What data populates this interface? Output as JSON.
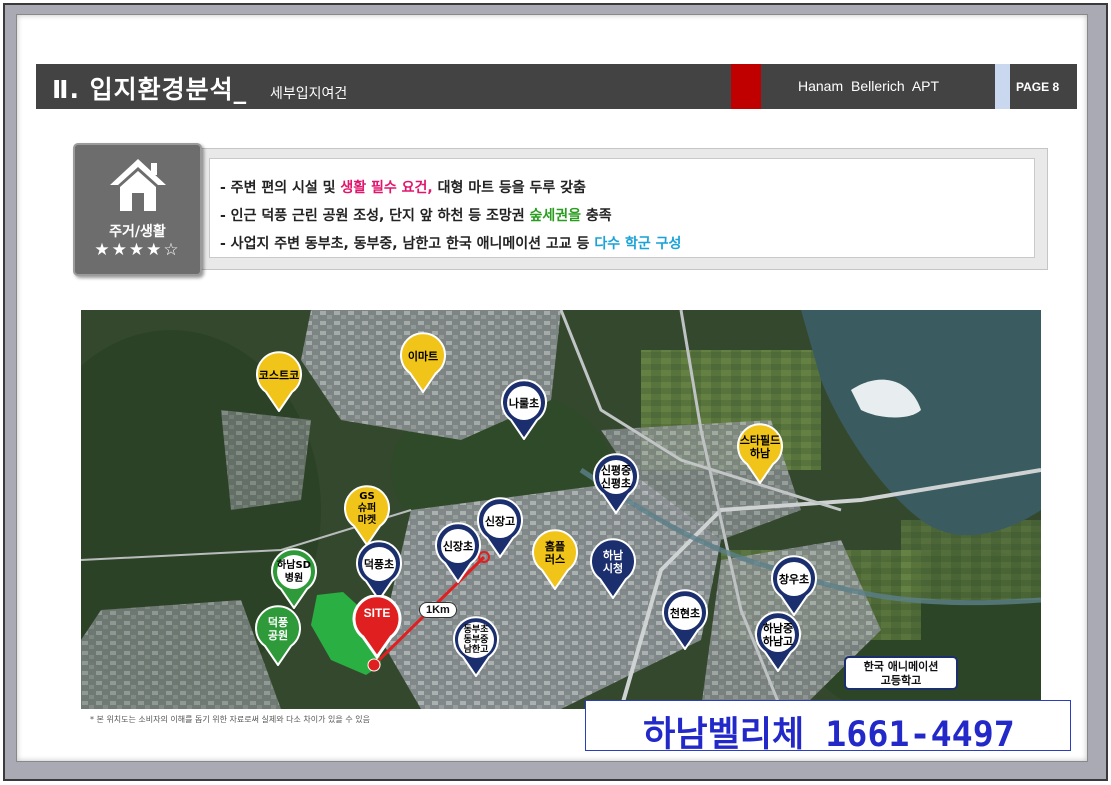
{
  "header": {
    "title": "Ⅱ. 입지환경분석_",
    "subtitle": "세부입지여건",
    "apt_name": "Hanam  Bellerich  APT",
    "page": "PAGE 8"
  },
  "category": {
    "label": "주거/생활",
    "stars": "★★★★☆",
    "icon": "house-icon"
  },
  "summary": {
    "line1": {
      "pre": "- 주변 편의 시설 및 ",
      "hl": "생활 필수 요건,",
      "post": " 대형 마트 등을 두루 갖춤"
    },
    "line2": {
      "pre": "- 인근 덕풍 근린 공원 조성, 단지 앞 하천 등 조망권 ",
      "hl": "숲세권을",
      "post": " 충족"
    },
    "line3": {
      "pre": "- 사업지 주변 동부초, 동부중, 남한고 한국 애니메이션 고교 등 ",
      "hl": "다수 학군 구성",
      "post": ""
    }
  },
  "map": {
    "pins": {
      "costco": "코스트코",
      "emart": "이마트",
      "naru": "나룰초",
      "starfield": "스타필드\n하남",
      "sinpyeong": "신평중\n신평초",
      "gs": "GS\n슈퍼\n마켓",
      "sinjang_high": "신장고",
      "sinjang_elem": "신장초",
      "homeplus": "홈플\n러스",
      "cityhall": "하남\n시청",
      "hanam_sd": "하남SD\n병원",
      "deokpung_elem": "덕풍초",
      "changwoo": "창우초",
      "deokpung_park": "덕풍\n공원",
      "dongbu": "동부초\n동부중\n남한고",
      "cheonhyeon": "천현초",
      "hanam_mid": "하남중\n하남고"
    },
    "site_label": "SITE",
    "distance": "1Km",
    "animation_school": "한국 애니메이션\n고등학고"
  },
  "disclaimer": "* 본 위치도는 소비자의 이해를 돕기 위한 자료로써 실제와 다소 차이가 있을 수 있음",
  "phone": "하남벨리체 1661-4497",
  "colors": {
    "header_bg": "#434343",
    "accent_red": "#c00000",
    "pin_yellow": "#f0c419",
    "pin_navy": "#1b2f6e",
    "pin_green": "#2f9a3a",
    "site_red": "#e02020",
    "phone_blue": "#2329c9"
  }
}
